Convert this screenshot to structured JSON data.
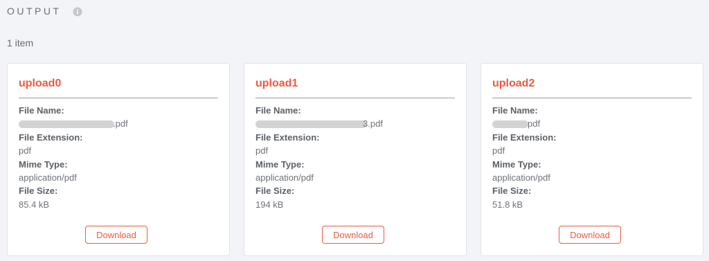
{
  "section": {
    "title": "OUTPUT",
    "item_count": "1 item"
  },
  "icons": {
    "info": "info-icon"
  },
  "colors": {
    "accent": "#ee5a3f",
    "background": "#f3f4f8",
    "card": "#ffffff"
  },
  "labels": {
    "file_name": "File Name:",
    "file_extension": "File Extension:",
    "mime_type": "Mime Type:",
    "file_size": "File Size:",
    "download": "Download"
  },
  "cards": [
    {
      "title": "upload0",
      "file_name_visible": ".pdf",
      "file_extension": "pdf",
      "mime_type": "application/pdf",
      "file_size": "85.4 kB"
    },
    {
      "title": "upload1",
      "file_name_visible": "3.pdf",
      "file_extension": "pdf",
      "mime_type": "application/pdf",
      "file_size": "194 kB"
    },
    {
      "title": "upload2",
      "file_name_visible": "pdf",
      "file_extension": "pdf",
      "mime_type": "application/pdf",
      "file_size": "51.8 kB"
    }
  ]
}
